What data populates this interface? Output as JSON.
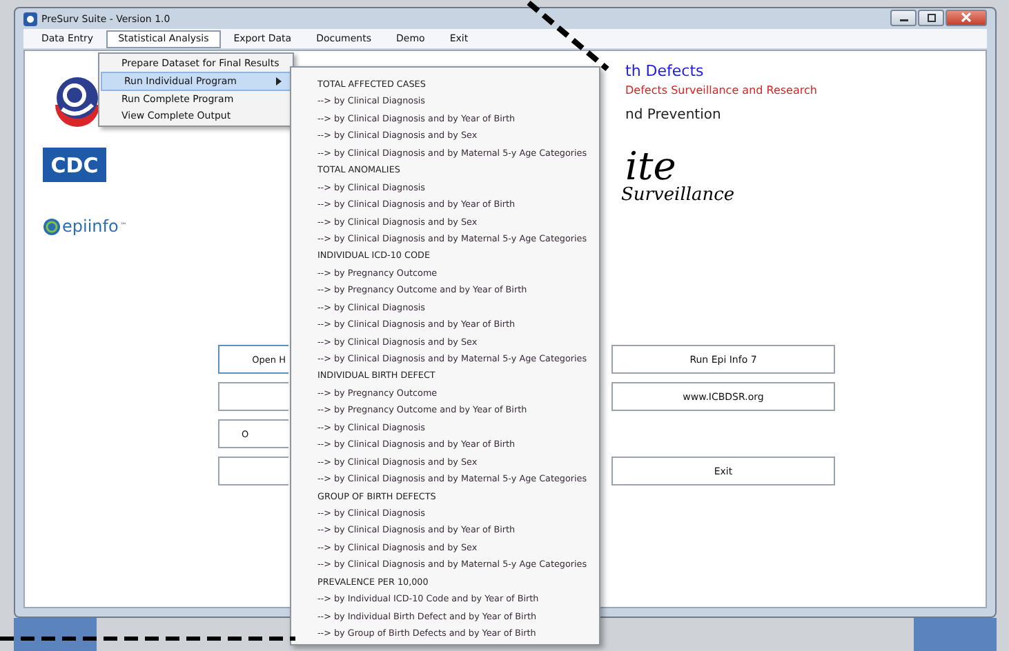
{
  "window": {
    "title": "PreSurv Suite - Version 1.0"
  },
  "menu_bar": [
    {
      "label": "Data Entry",
      "selected": false
    },
    {
      "label": "Statistical Analysis",
      "selected": true
    },
    {
      "label": "Export Data",
      "selected": false
    },
    {
      "label": "Documents",
      "selected": false
    },
    {
      "label": "Demo",
      "selected": false
    },
    {
      "label": "Exit",
      "selected": false
    }
  ],
  "dropdown": [
    {
      "label": "Prepare Dataset for Final Results",
      "selected": false,
      "submenu": false
    },
    {
      "label": "Run Individual Program",
      "selected": true,
      "submenu": true
    },
    {
      "label": "Run Complete Program",
      "selected": false,
      "submenu": false
    },
    {
      "label": "View Complete Output",
      "selected": false,
      "submenu": false
    }
  ],
  "submenu": [
    {
      "kind": "header",
      "label": "TOTAL AFFECTED CASES"
    },
    {
      "kind": "item",
      "label": "--> by Clinical Diagnosis"
    },
    {
      "kind": "item",
      "label": "--> by Clinical Diagnosis and by Year of Birth"
    },
    {
      "kind": "item",
      "label": "--> by Clinical Diagnosis and by Sex"
    },
    {
      "kind": "item",
      "label": "--> by Clinical Diagnosis and by Maternal 5-y Age Categories"
    },
    {
      "kind": "header",
      "label": "TOTAL ANOMALIES"
    },
    {
      "kind": "item",
      "label": "--> by Clinical Diagnosis"
    },
    {
      "kind": "item",
      "label": "--> by Clinical Diagnosis and by Year of Birth"
    },
    {
      "kind": "item",
      "label": "--> by Clinical Diagnosis and by Sex"
    },
    {
      "kind": "item",
      "label": "--> by Clinical Diagnosis and by Maternal 5-y Age Categories"
    },
    {
      "kind": "header",
      "label": "INDIVIDUAL ICD-10 CODE"
    },
    {
      "kind": "item",
      "label": "--> by Pregnancy Outcome"
    },
    {
      "kind": "item",
      "label": "--> by Pregnancy Outcome and by Year of Birth"
    },
    {
      "kind": "item",
      "label": "--> by Clinical Diagnosis"
    },
    {
      "kind": "item",
      "label": "--> by Clinical Diagnosis and by Year of Birth"
    },
    {
      "kind": "item",
      "label": "--> by Clinical Diagnosis and by Sex"
    },
    {
      "kind": "item",
      "label": "--> by Clinical Diagnosis and by Maternal 5-y Age Categories"
    },
    {
      "kind": "header",
      "label": "INDIVIDUAL BIRTH DEFECT"
    },
    {
      "kind": "item",
      "label": "--> by Pregnancy Outcome"
    },
    {
      "kind": "item",
      "label": "--> by Pregnancy Outcome and by Year of Birth"
    },
    {
      "kind": "item",
      "label": "--> by Clinical Diagnosis"
    },
    {
      "kind": "item",
      "label": "--> by Clinical Diagnosis and by Year of Birth"
    },
    {
      "kind": "item",
      "label": "--> by Clinical Diagnosis and by Sex"
    },
    {
      "kind": "item",
      "label": "--> by Clinical Diagnosis and by Maternal 5-y Age Categories"
    },
    {
      "kind": "header",
      "label": "GROUP OF BIRTH DEFECTS"
    },
    {
      "kind": "item",
      "label": "--> by Clinical Diagnosis"
    },
    {
      "kind": "item",
      "label": "--> by Clinical Diagnosis and by Year of Birth"
    },
    {
      "kind": "item",
      "label": "--> by Clinical Diagnosis and by Sex"
    },
    {
      "kind": "item",
      "label": "--> by Clinical Diagnosis and by Maternal 5-y Age Categories"
    },
    {
      "kind": "header",
      "label": "PREVALENCE PER 10,000"
    },
    {
      "kind": "item",
      "label": "--> by Individual ICD-10 Code and by Year of Birth"
    },
    {
      "kind": "item",
      "label": "--> by Individual Birth Defect and by Year of Birth"
    },
    {
      "kind": "item",
      "label": "--> by Group of Birth Defects and by Year of Birth"
    }
  ],
  "header_texts": {
    "org": "th Defects",
    "subtitle": "Defects Surveillance and Research",
    "partner": "nd Prevention",
    "suite": "ite",
    "tagline": "Surveillance"
  },
  "logos": {
    "cdc": "CDC",
    "epi": "epiinfo",
    "tm": "™"
  },
  "button_rows": [
    {
      "left": {
        "kind": "labeled",
        "label": "Open H"
      },
      "right": {
        "kind": "labeled",
        "label": "Run Epi Info 7"
      }
    },
    {
      "left": {
        "kind": "blank"
      },
      "right": {
        "kind": "labeled",
        "label": "www.ICBDSR.org"
      }
    },
    {
      "left": {
        "kind": "labeled",
        "label": "O"
      }
    },
    {
      "left": {
        "kind": "blank"
      },
      "right": {
        "kind": "labeled",
        "label": "Exit"
      }
    }
  ]
}
